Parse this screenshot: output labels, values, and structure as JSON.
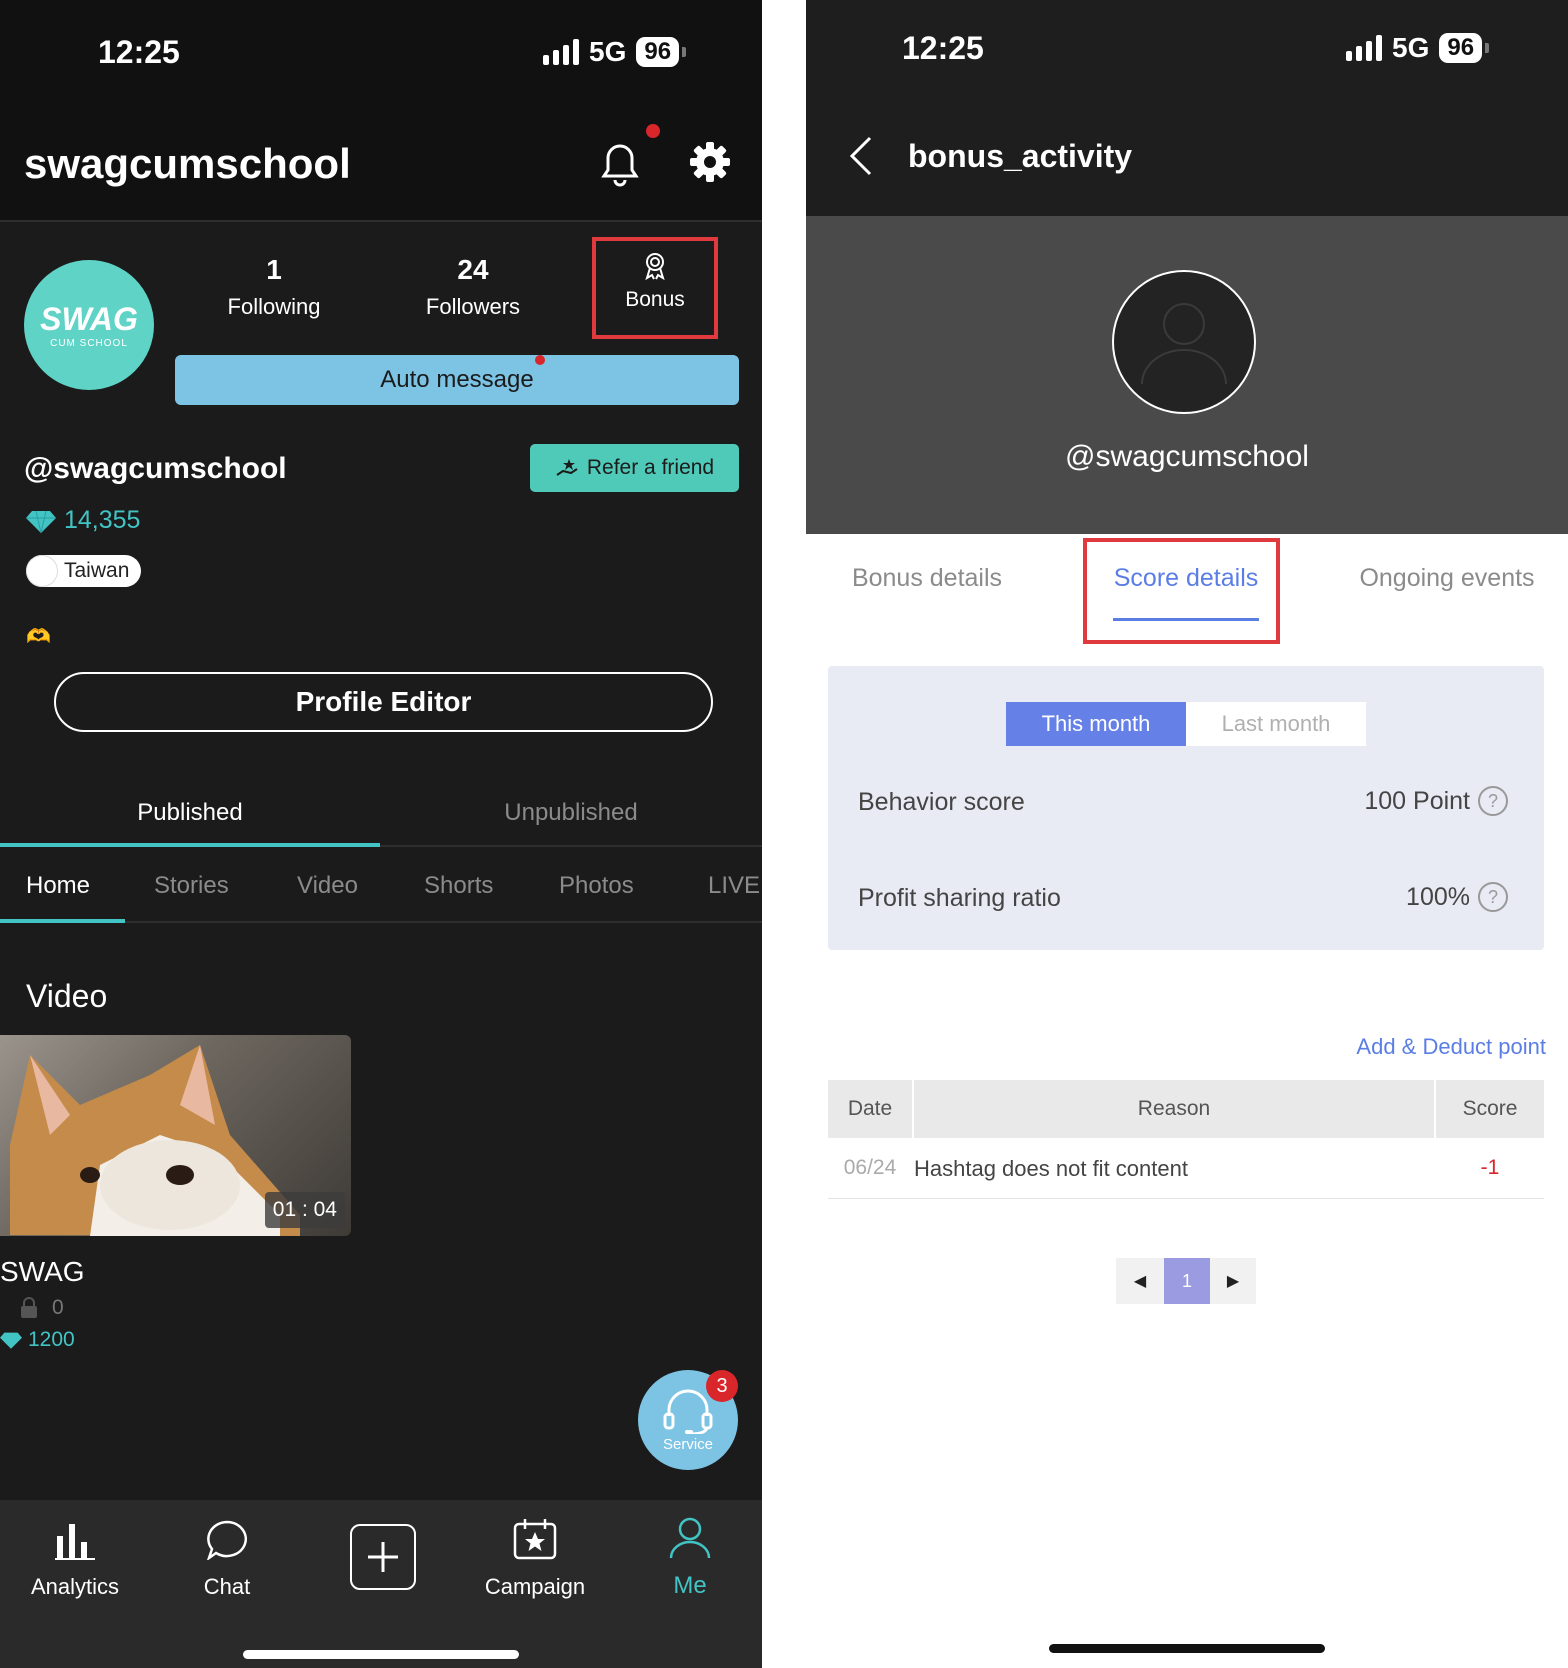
{
  "left": {
    "status": {
      "time": "12:25",
      "network": "5G",
      "battery": "96"
    },
    "header": {
      "title": "swagcumschool"
    },
    "stats": {
      "following": {
        "value": "1",
        "label": "Following"
      },
      "followers": {
        "value": "24",
        "label": "Followers"
      },
      "bonus_label": "Bonus"
    },
    "avatar": {
      "logo_text": "SWAG",
      "logo_sub": "CUM SCHOOL"
    },
    "auto_message": "Auto message",
    "handle": "@swagcumschool",
    "refer_label": "Refer a friend",
    "diamonds": "14,355",
    "location": "Taiwan",
    "profile_editor": "Profile Editor",
    "main_tabs": [
      "Published",
      "Unpublished"
    ],
    "sub_tabs": [
      "Home",
      "Stories",
      "Video",
      "Shorts",
      "Photos",
      "LIVE"
    ],
    "section_title": "Video",
    "video": {
      "duration": "01 : 04",
      "title": "SWAG",
      "locks": "0",
      "price": "1200"
    },
    "service": {
      "label": "Service",
      "badge": "3"
    },
    "bottom_nav": [
      "Analytics",
      "Chat",
      "",
      "Campaign",
      "Me"
    ]
  },
  "right": {
    "status": {
      "time": "12:25",
      "network": "5G",
      "battery": "96"
    },
    "header": {
      "title": "bonus_activity"
    },
    "profile_handle": "@swagcumschool",
    "tabs": [
      "Bonus details",
      "Score details",
      "Ongoing events"
    ],
    "toggle": [
      "This month",
      "Last month"
    ],
    "rows": [
      {
        "label": "Behavior score",
        "value": "100 Point"
      },
      {
        "label": "Profit sharing ratio",
        "value": "100%"
      }
    ],
    "add_deduct": "Add & Deduct point",
    "table": {
      "headers": [
        "Date",
        "Reason",
        "Score"
      ],
      "rows": [
        {
          "date": "06/24",
          "reason": "Hashtag does not fit content",
          "score": "-1"
        }
      ]
    },
    "pagination": {
      "prev": "◀",
      "page": "1",
      "next": "▶"
    }
  },
  "colors": {
    "accent_cyan": "#43c4c4",
    "accent_blue": "#5b7ee5",
    "highlight_red": "#e03a3e",
    "auto_msg_bg": "#7cc3e4"
  }
}
